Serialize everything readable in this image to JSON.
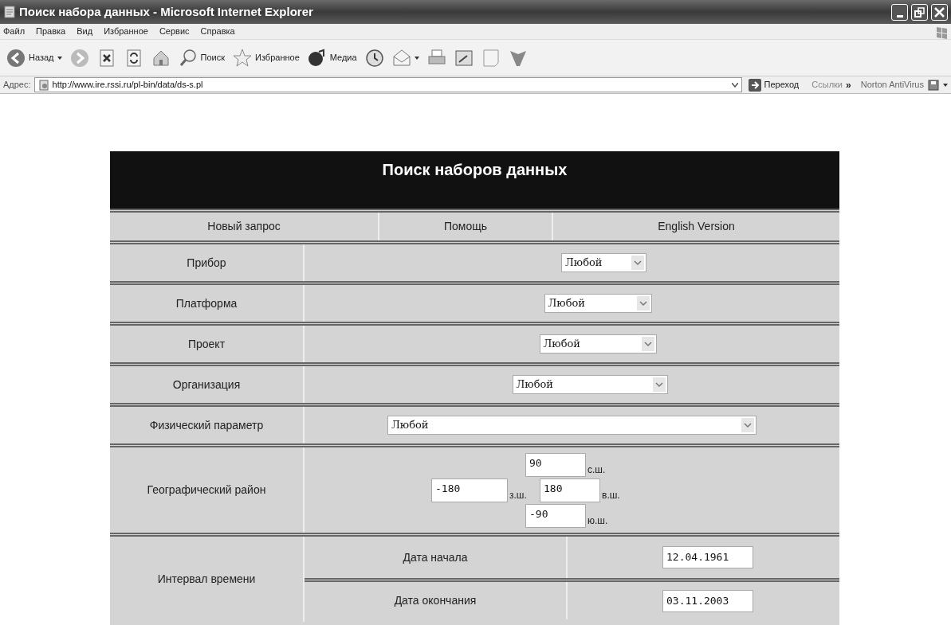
{
  "window": {
    "title": "Поиск набора данных - Microsoft Internet Explorer"
  },
  "menu": [
    "Файл",
    "Правка",
    "Вид",
    "Избранное",
    "Сервис",
    "Справка"
  ],
  "toolbar": [
    {
      "kind": "back",
      "label": "Назад"
    },
    {
      "kind": "forward"
    },
    {
      "kind": "stop"
    },
    {
      "kind": "refresh"
    },
    {
      "kind": "home"
    },
    {
      "kind": "search",
      "label": "Поиск"
    },
    {
      "kind": "favorites",
      "label": "Избранное"
    },
    {
      "kind": "media",
      "label": "Медиа"
    },
    {
      "kind": "history"
    },
    {
      "kind": "mail"
    },
    {
      "kind": "print"
    },
    {
      "kind": "edit"
    },
    {
      "kind": "note"
    },
    {
      "kind": "funnel"
    }
  ],
  "address_bar": {
    "label": "Адрес:",
    "url": "http://www.ire.rssi.ru/pl-bin/data/ds-s.pl",
    "go": "Переход",
    "links": "Ссылки",
    "chevron": "»",
    "addon": "Norton AntiVirus"
  },
  "page": {
    "heading": "Поиск наборов данных",
    "nav": [
      "Новый запрос",
      "Помощь",
      "English Version"
    ],
    "fields": [
      {
        "label": "Прибор",
        "value": "Любой"
      },
      {
        "label": "Платформа",
        "value": "Любой"
      },
      {
        "label": "Проект",
        "value": "Любой"
      },
      {
        "label": "Организация",
        "value": "Любой"
      },
      {
        "label": "Физический параметр",
        "value": "Любой"
      }
    ],
    "region": {
      "label": "Географический район",
      "north": "90",
      "north_unit": "с.ш.",
      "west": "-180",
      "west_unit": "з.ш.",
      "east": "180",
      "east_unit": "в.ш.",
      "south": "-90",
      "south_unit": "ю.ш."
    },
    "interval": {
      "label": "Интервал времени",
      "start_label": "Дата начала",
      "start": "12.04.1961",
      "end_label": "Дата окончания",
      "end": "03.11.2003"
    }
  }
}
